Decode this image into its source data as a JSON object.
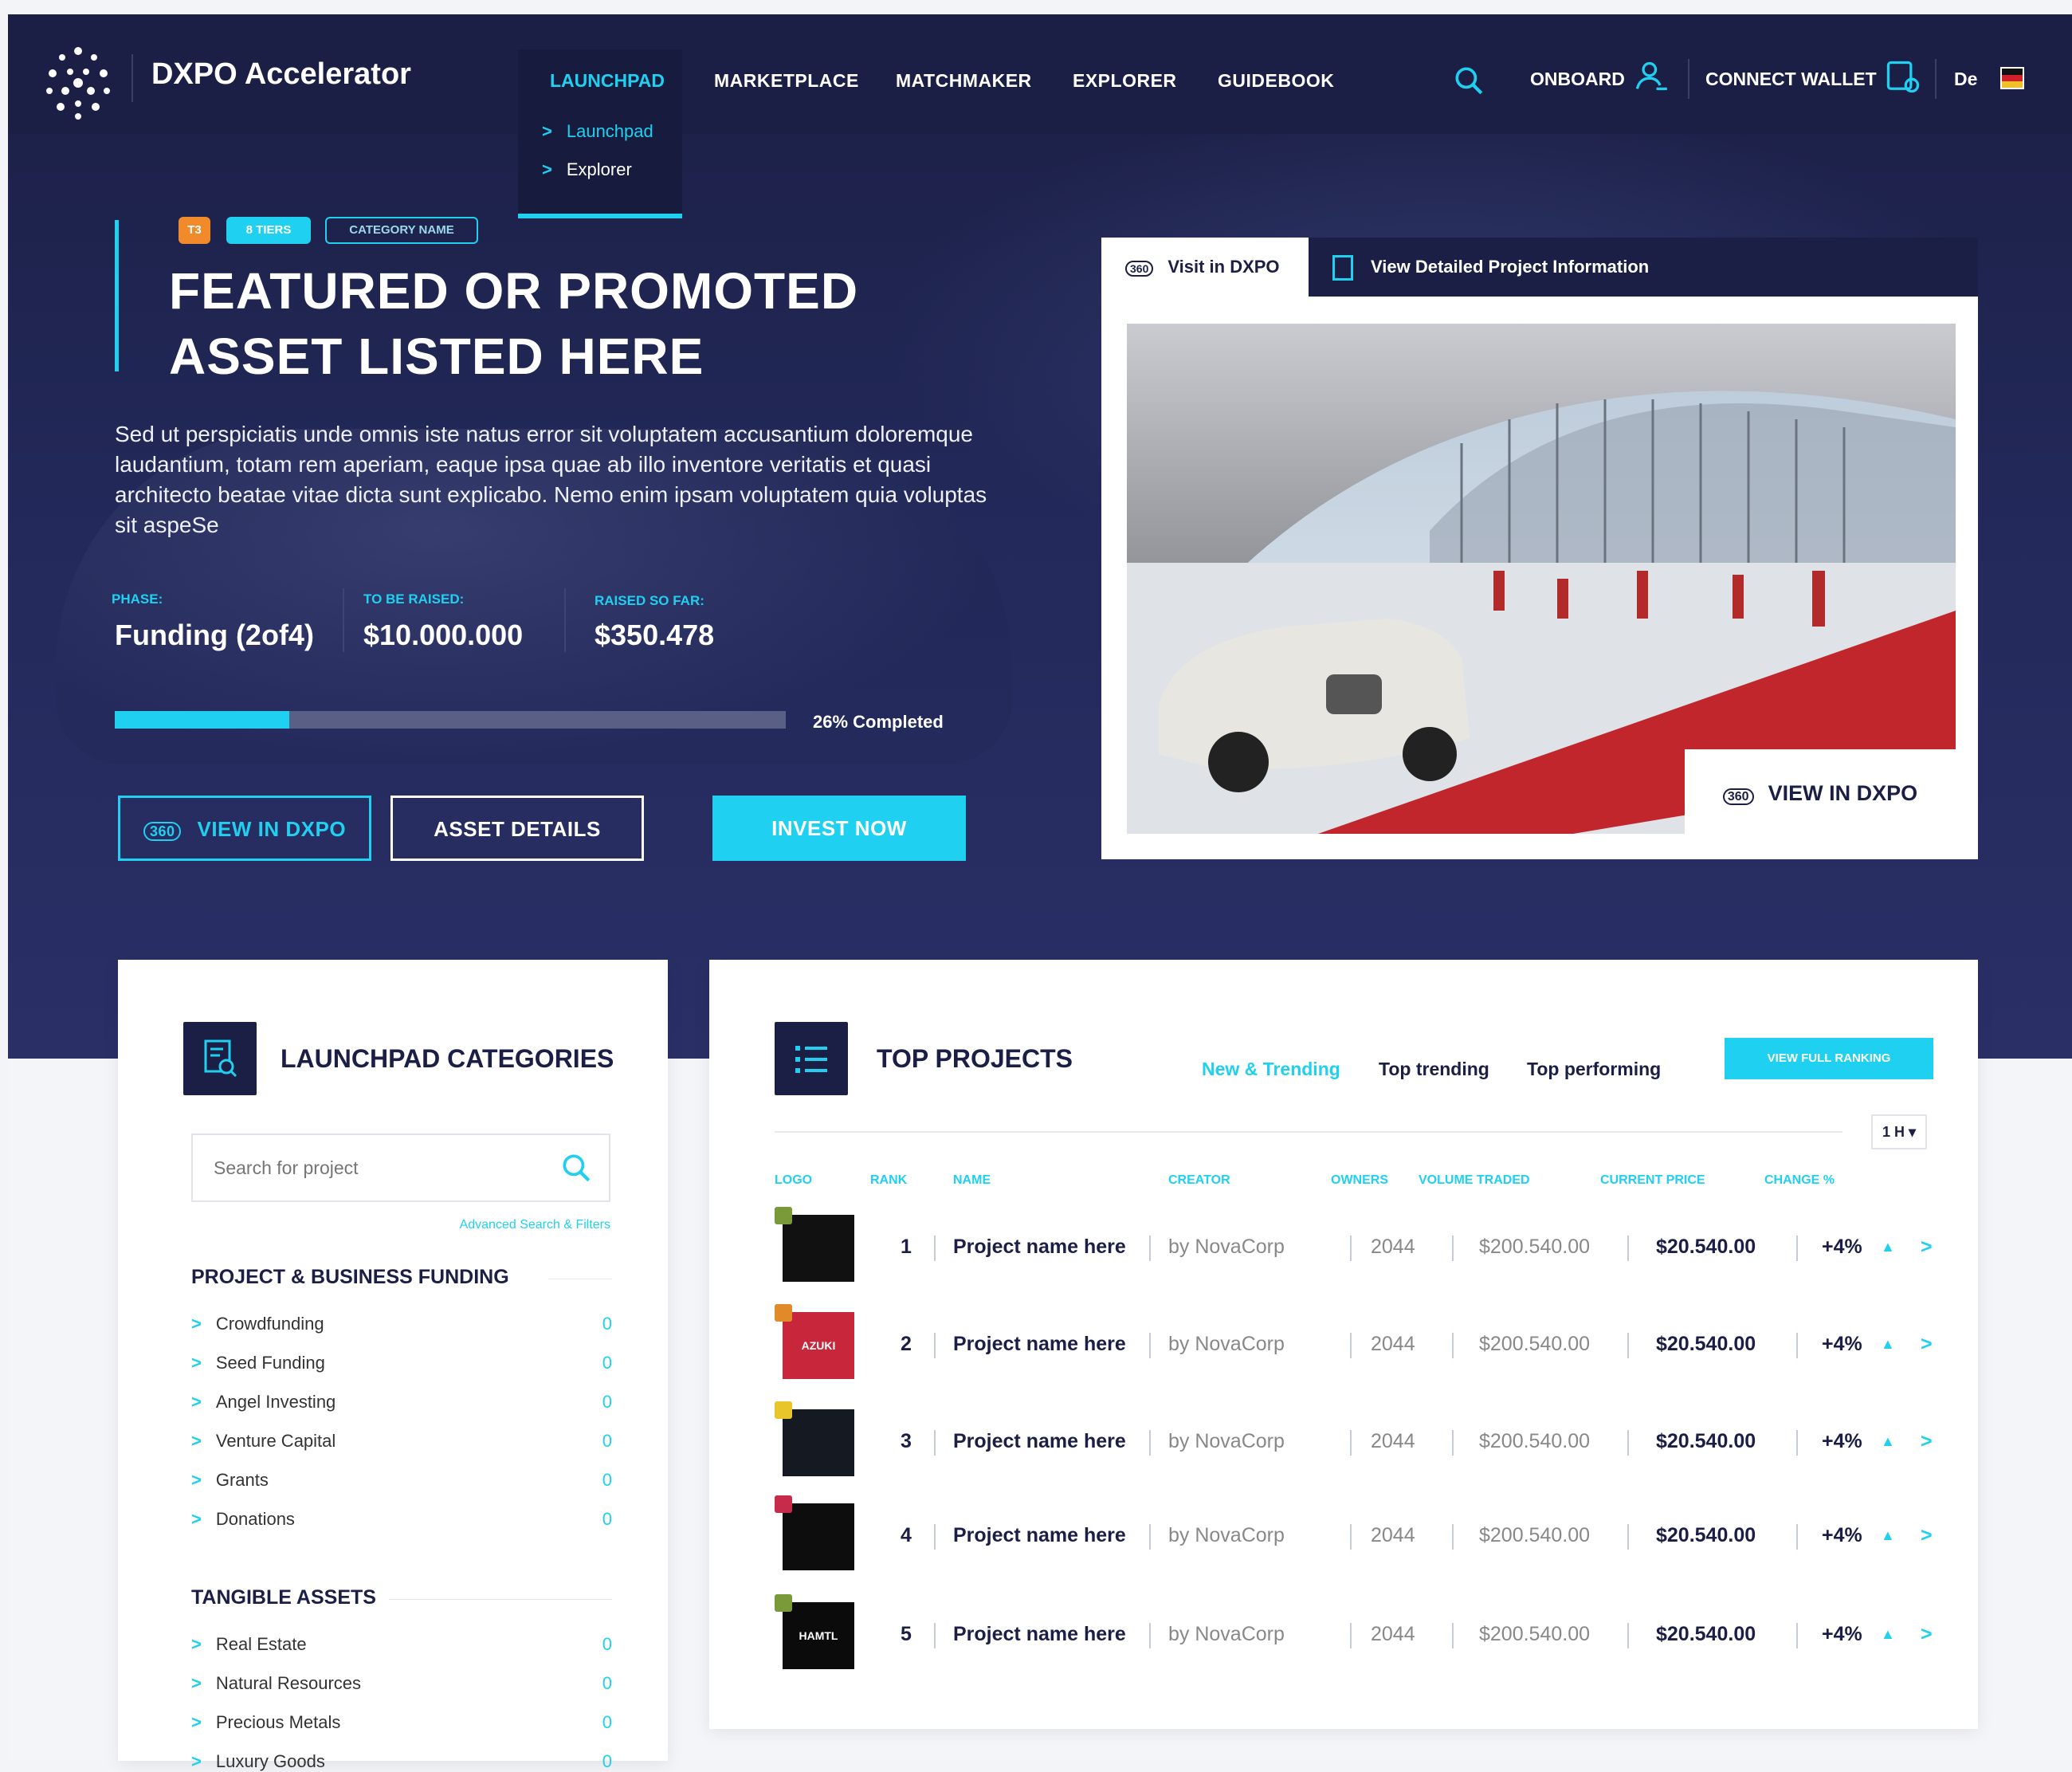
{
  "brand": {
    "name": "DXPO Accelerator"
  },
  "nav": {
    "items": [
      "LAUNCHPAD",
      "MARKETPLACE",
      "MATCHMAKER",
      "EXPLORER",
      "GUIDEBOOK"
    ],
    "submenu": [
      "Launchpad",
      "Explorer"
    ]
  },
  "topright": {
    "onboard": "ONBOARD",
    "connect_wallet": "CONNECT WALLET",
    "lang": "De"
  },
  "hero": {
    "tags": [
      "T3",
      "8 TIERS",
      "CATEGORY NAME"
    ],
    "title_line1": "FEATURED OR PROMOTED",
    "title_line2": "ASSET LISTED HERE",
    "description": "Sed ut perspiciatis unde omnis iste natus error sit voluptatem accusantium doloremque laudantium, totam rem aperiam, eaque ipsa quae ab illo inventore veritatis et quasi architecto beatae vitae dicta sunt explicabo. Nemo enim ipsam voluptatem quia voluptas sit aspeSe",
    "phase_label": "PHASE:",
    "phase_value": "Funding (2of4)",
    "raise_label": "TO BE RAISED:",
    "raise_value": "$10.000.000",
    "raised_label": "RAISED SO FAR:",
    "raised_value": "$350.478",
    "progress": 0.26,
    "progress_text": "26% Completed",
    "btn_view": "VIEW IN DXPO",
    "btn_details": "ASSET DETAILS",
    "btn_invest": "INVEST NOW"
  },
  "card": {
    "tab_visit": "Visit in DXPO",
    "tab_info": "View Detailed Project Information",
    "view_btn": "VIEW IN DXPO",
    "icon_360": "360"
  },
  "categories": {
    "title": "LAUNCHPAD CATEGORIES",
    "search_placeholder": "Search for project",
    "advanced": "Advanced Search & Filters",
    "groups": [
      {
        "name": "PROJECT & BUSINESS FUNDING",
        "items": [
          {
            "label": "Crowdfunding",
            "count": "0"
          },
          {
            "label": "Seed Funding",
            "count": "0"
          },
          {
            "label": "Angel Investing",
            "count": "0"
          },
          {
            "label": "Venture Capital",
            "count": "0"
          },
          {
            "label": "Grants",
            "count": "0"
          },
          {
            "label": "Donations",
            "count": "0"
          }
        ]
      },
      {
        "name": "TANGIBLE ASSETS",
        "items": [
          {
            "label": "Real Estate",
            "count": "0"
          },
          {
            "label": "Natural Resources",
            "count": "0"
          },
          {
            "label": "Precious Metals",
            "count": "0"
          },
          {
            "label": "Luxury Goods",
            "count": "0"
          }
        ]
      }
    ]
  },
  "top": {
    "title": "TOP PROJECTS",
    "tabs": [
      "New & Trending",
      "Top trending",
      "Top performing"
    ],
    "view_full": "VIEW FULL RANKING",
    "interval": "1 H ▾",
    "columns": [
      "LOGO",
      "RANK",
      "NAME",
      "CREATOR",
      "OWNERS",
      "VOLUME TRADED",
      "CURRENT PRICE",
      "CHANGE %"
    ],
    "rows": [
      {
        "rank": "1",
        "name": "Project name here",
        "creator": "by NovaCorp",
        "owners": "2044",
        "volume": "$200.540.00",
        "price": "$20.540.00",
        "change": "+4%",
        "logo_text": "",
        "logo_bg": "#111",
        "badge": "#7a9a3a"
      },
      {
        "rank": "2",
        "name": "Project name here",
        "creator": "by NovaCorp",
        "owners": "2044",
        "volume": "$200.540.00",
        "price": "$20.540.00",
        "change": "+4%",
        "logo_text": "AZUKI",
        "logo_bg": "#c8263a",
        "badge": "#e08a2a"
      },
      {
        "rank": "3",
        "name": "Project name here",
        "creator": "by NovaCorp",
        "owners": "2044",
        "volume": "$200.540.00",
        "price": "$20.540.00",
        "change": "+4%",
        "logo_text": "",
        "logo_bg": "#151a22",
        "badge": "#e8c52a"
      },
      {
        "rank": "4",
        "name": "Project name here",
        "creator": "by NovaCorp",
        "owners": "2044",
        "volume": "$200.540.00",
        "price": "$20.540.00",
        "change": "+4%",
        "logo_text": "",
        "logo_bg": "#0d0d0d",
        "badge": "#c82a4a"
      },
      {
        "rank": "5",
        "name": "Project name here",
        "creator": "by NovaCorp",
        "owners": "2044",
        "volume": "$200.540.00",
        "price": "$20.540.00",
        "change": "+4%",
        "logo_text": "HAMTL",
        "logo_bg": "#0b0b0b",
        "badge": "#7a9a3a"
      }
    ]
  },
  "colors": {
    "accent": "#1fd0f0",
    "navy": "#1b1f45",
    "orange": "#f08a2a"
  }
}
